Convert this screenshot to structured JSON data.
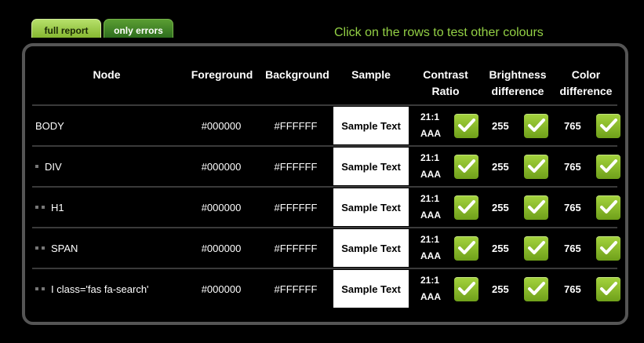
{
  "tabs": {
    "full_report": "full report",
    "only_errors": "only errors"
  },
  "hint": "Click on the rows to test other colours",
  "headers": {
    "node": "Node",
    "foreground": "Foreground",
    "background": "Background",
    "sample": "Sample",
    "contrast_1": "Contrast",
    "contrast_2": "Ratio",
    "brightness_1": "Brightness",
    "brightness_2": "difference",
    "color_1": "Color",
    "color_2": "difference"
  },
  "rows": [
    {
      "node": "BODY",
      "indent": 0,
      "foreground": "#000000",
      "background": "#FFFFFF",
      "sample": "Sample Text",
      "ratio": "21:1",
      "level": "AAA",
      "brightness": "255",
      "color_diff": "765"
    },
    {
      "node": "DIV",
      "indent": 1,
      "foreground": "#000000",
      "background": "#FFFFFF",
      "sample": "Sample Text",
      "ratio": "21:1",
      "level": "AAA",
      "brightness": "255",
      "color_diff": "765"
    },
    {
      "node": "H1",
      "indent": 2,
      "foreground": "#000000",
      "background": "#FFFFFF",
      "sample": "Sample Text",
      "ratio": "21:1",
      "level": "AAA",
      "brightness": "255",
      "color_diff": "765"
    },
    {
      "node": "SPAN",
      "indent": 2,
      "foreground": "#000000",
      "background": "#FFFFFF",
      "sample": "Sample Text",
      "ratio": "21:1",
      "level": "AAA",
      "brightness": "255",
      "color_diff": "765"
    },
    {
      "node": "I  class='fas fa-search'",
      "indent": 2,
      "foreground": "#000000",
      "background": "#FFFFFF",
      "sample": "Sample Text",
      "ratio": "21:1",
      "level": "AAA",
      "brightness": "255",
      "color_diff": "765"
    }
  ],
  "colors": {
    "accent_green": "#93d045",
    "check_green": "#8cc231",
    "panel_border": "#555555"
  }
}
